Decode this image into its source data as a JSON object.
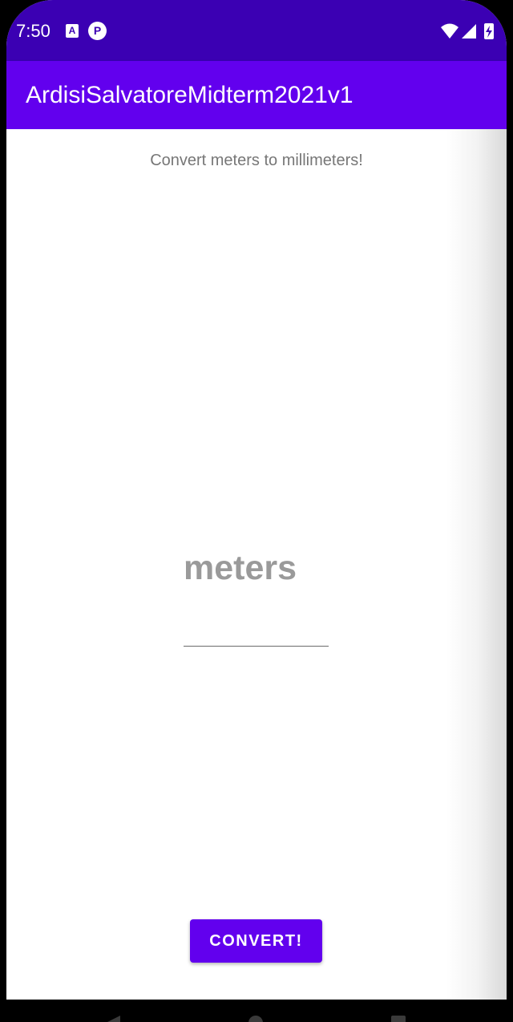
{
  "status_bar": {
    "time": "7:50",
    "icons": [
      "text-a-icon",
      "pinterest-p-icon",
      "wifi-icon",
      "signal-icon",
      "battery-charging-icon"
    ],
    "notification_a_glyph": "A",
    "notification_p_glyph": "P"
  },
  "app_bar": {
    "title": "ArdisiSalvatoreMidterm2021v1",
    "color": "#6200ee"
  },
  "main": {
    "subtitle": "Convert meters to millimeters!",
    "meters_input": {
      "value": "",
      "hint": "meters"
    },
    "convert_button": {
      "label": "CONVERT!",
      "color": "#6200ee"
    }
  },
  "colors": {
    "status_bar": "#3b00b3",
    "primary": "#6200ee",
    "subtitle_text": "#777777",
    "hint_text": "#9a9a9a"
  }
}
